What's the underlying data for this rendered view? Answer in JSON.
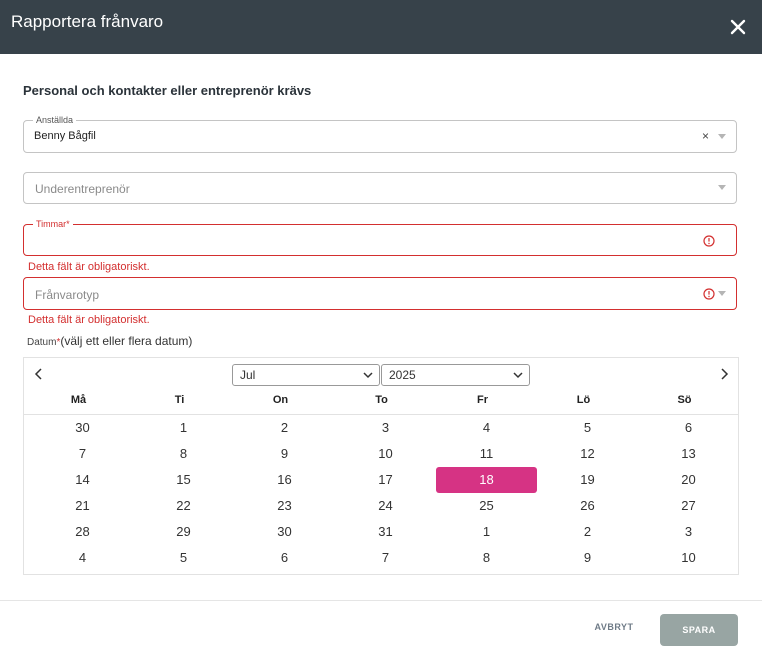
{
  "dialog": {
    "title": "Rapportera frånvaro",
    "section_title": "Personal och kontakter eller entreprenör krävs"
  },
  "fields": {
    "employees": {
      "label": "Anställda",
      "value": "Benny Bågfil",
      "clear": "×"
    },
    "subcontractor": {
      "placeholder": "Underentreprenör"
    },
    "hours": {
      "label": "Timmar*",
      "value": "",
      "error": "Detta fält är obligatoriskt."
    },
    "absence_type": {
      "placeholder": "Frånvarotyp",
      "error": "Detta fält är obligatoriskt."
    }
  },
  "datum": {
    "label": "Datum",
    "required": "*",
    "hint": "(välj ett eller flera datum)"
  },
  "calendar": {
    "month": "Jul",
    "year": "2025",
    "selected_day": 18,
    "day_names": [
      "Må",
      "Ti",
      "On",
      "To",
      "Fr",
      "Lö",
      "Sö"
    ],
    "weeks": [
      [
        30,
        1,
        2,
        3,
        4,
        5,
        6
      ],
      [
        7,
        8,
        9,
        10,
        11,
        12,
        13
      ],
      [
        14,
        15,
        16,
        17,
        18,
        19,
        20
      ],
      [
        21,
        22,
        23,
        24,
        25,
        26,
        27
      ],
      [
        28,
        29,
        30,
        31,
        1,
        2,
        3
      ],
      [
        4,
        5,
        6,
        7,
        8,
        9,
        10
      ]
    ]
  },
  "footer": {
    "cancel": "AVBRYT",
    "save": "SPARA"
  },
  "colors": {
    "header_bg": "#37424a",
    "error": "#d32f2f",
    "selected": "#d63384",
    "save_bg": "#98a5a3"
  }
}
